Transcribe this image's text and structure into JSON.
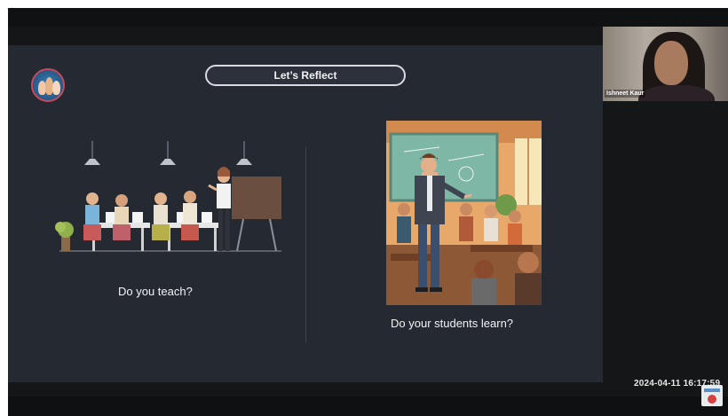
{
  "slide": {
    "title": "Let’s Reflect",
    "left_caption": "Do you teach?",
    "right_caption": "Do your students learn?",
    "icons": {
      "logo": "group-avatar-icon",
      "left_art": "classroom-presentation-illustration",
      "right_art": "teacher-classroom-illustration"
    }
  },
  "webcam": {
    "participant_name": "Ishneet Kaur"
  },
  "overlay": {
    "timestamp": "2024-04-11  16:17:59",
    "corner_icon": "app-logo-icon"
  },
  "colors": {
    "screen_bg": "#151617",
    "slide_bg": "#252932",
    "text": "#f2f3f5",
    "accent_red": "#c94a5c"
  }
}
